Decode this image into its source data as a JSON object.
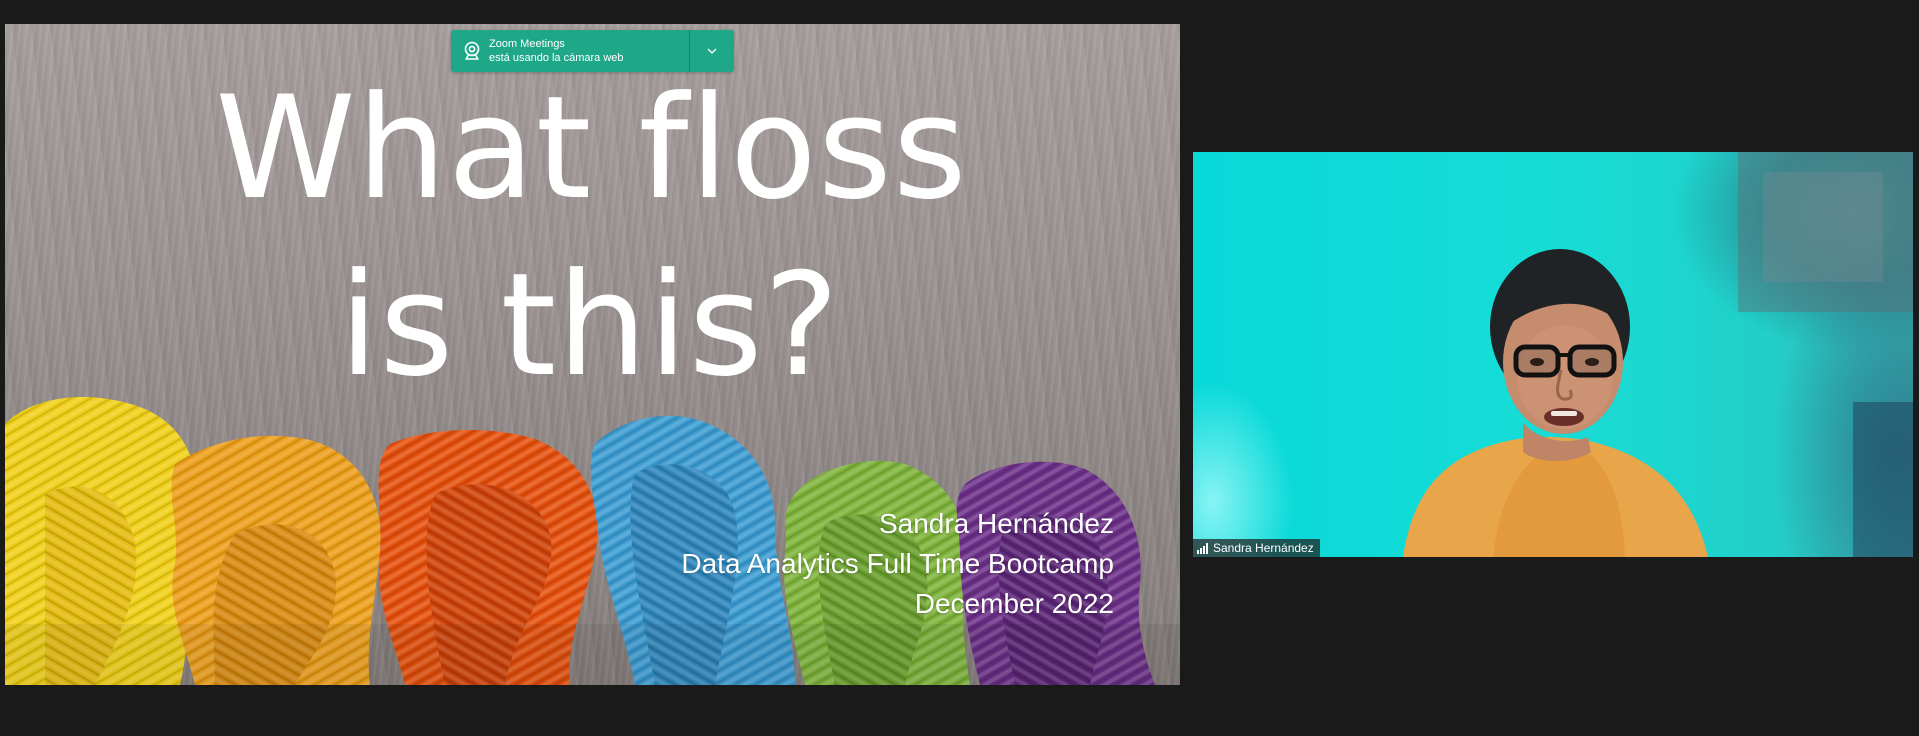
{
  "app": {
    "name": "Zoom Meetings"
  },
  "notification": {
    "app_name": "Zoom Meetings",
    "message": "está usando la cámara web",
    "icon": "webcam-icon",
    "menu_icon": "chevron-down-icon",
    "background_color": "#1ea888"
  },
  "shared_slide": {
    "title_line1": "What floss",
    "title_line2": "is this?",
    "presenter_name": "Sandra Hernández",
    "program": "Data Analytics Full Time Bootcamp",
    "date": "December 2022",
    "yarn_colors": [
      "#f2d21a",
      "#eea21b",
      "#e8500e",
      "#3a9bd0",
      "#7fb43a",
      "#6a2f86"
    ]
  },
  "participant": {
    "name": "Sandra Hernández",
    "signal_icon": "signal-strength-icon",
    "background_color": "#0fd9d9"
  }
}
